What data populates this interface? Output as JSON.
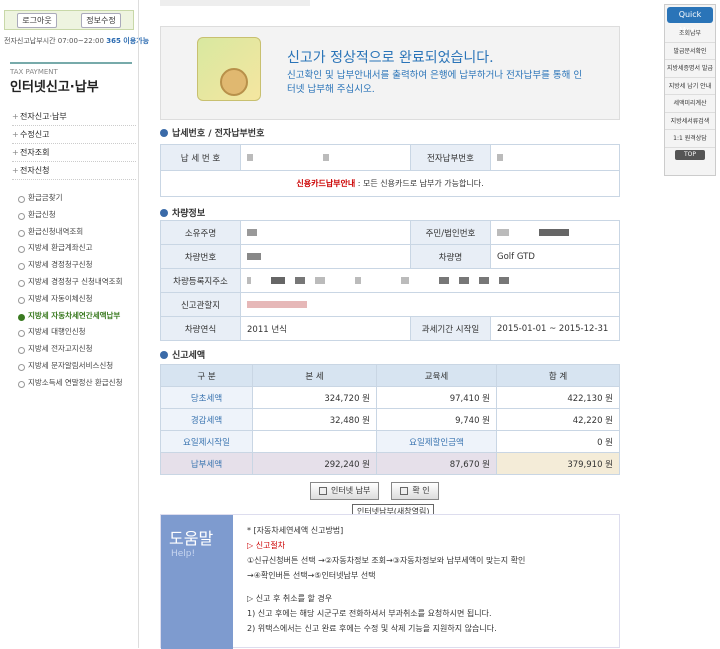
{
  "left": {
    "logout": "로그아웃",
    "edit_info": "정보수정",
    "hours": "전자신고납부시간 07:00~22:00",
    "hours_365": "365 이용가능",
    "tax_payment_en": "TAX PAYMENT",
    "tax_payment_ko": "인터넷신고·납부",
    "menu": [
      "전자신고·납부",
      "수정신고",
      "전자조회",
      "전자신청"
    ],
    "sub": [
      "환급금찾기",
      "환급신청",
      "환급신청내역조회",
      "지방세 환급계좌신고",
      "지방세 경정청구신청",
      "지방세 경정청구 신청내역조회",
      "지방세 자동이체신청",
      "지방세 자동차세연간세액납부",
      "지방세 대행인신청",
      "지방세 전자고지신청",
      "지방세 문자알림서비스신청",
      "지방소득세 연말정산 환급신청"
    ],
    "active_index": 7
  },
  "banner": {
    "title": "신고가 정상적으로 완료되었습니다.",
    "desc": "신고확인 및 납부안내서를 출력하여 은행에 납부하거나 전자납부를 통해 인터넷 납부해 주십시오."
  },
  "section1": {
    "title": "납세번호 / 전자납부번호",
    "tax_no_label": "납 세 번 호",
    "e_pay_label": "전자납부번호",
    "notice_bold": "신용카드납부안내",
    "notice_text": " : 모든 신용카드로 납부가 가능합니다."
  },
  "section2": {
    "title": "차량정보",
    "owner_label": "소유주명",
    "resident_label": "주민/법인번호",
    "car_no_label": "차량번호",
    "car_name_label": "차량명",
    "car_name": "Golf GTD",
    "address_label": "차량등록지주소",
    "office_label": "신고관할지",
    "year_label": "차량연식",
    "year": "2011 년식",
    "period_label": "과세기간 시작일",
    "period": "2015-01-01 ~ 2015-12-31"
  },
  "section3": {
    "title": "신고세액",
    "headers": [
      "구 분",
      "본 세",
      "교육세",
      "합 계"
    ],
    "rows": [
      {
        "label": "당초세액",
        "main": "324,720 원",
        "edu": "97,410 원",
        "total": "422,130 원"
      },
      {
        "label": "경감세액",
        "main": "32,480 원",
        "edu": "9,740 원",
        "total": "42,220 원"
      }
    ],
    "payment_start_label": "요일제시작일",
    "payment_discount_label": "요일제할인금액",
    "payment_discount": "0 원",
    "total_label": "납부세액",
    "total_main": "292,240 원",
    "total_edu": "87,670 원",
    "total_sum": "379,910 원"
  },
  "buttons": {
    "internet_pay": "인터넷 납부",
    "confirm": "확 인",
    "tooltip": "인터넷납부(새창열림)"
  },
  "help": {
    "title_ko": "도움말",
    "title_en": "Help!",
    "heading": "* [자동차세연세액 신고방법]",
    "proc_label": "▷ 신고절차",
    "line1": "①신규신청버튼 선택 →②자동차정보 조회→③자동차정보와 납부세액이 맞는지 확인",
    "line2": "→④확인버튼 선택→⑤인터넷납부 선택",
    "cancel_label": "▷ 신고 후 취소를 할 경우",
    "line3": "1) 신고 후에는 해당 시군구로 전화하셔서 부과취소를 요청하시면 됩니다.",
    "line4": "2) 위택스에서는 신고 완료 후에는 수정 및 삭제 기능을 지원하지 않습니다."
  },
  "quick": {
    "title": "Quick Menu",
    "items": [
      "조회납부",
      "발급문서확인",
      "지방세증명서 발급",
      "지방세 납기 안내",
      "세액미리계산",
      "지방세서류검색",
      "1:1 원격상담"
    ],
    "top": "TOP"
  }
}
